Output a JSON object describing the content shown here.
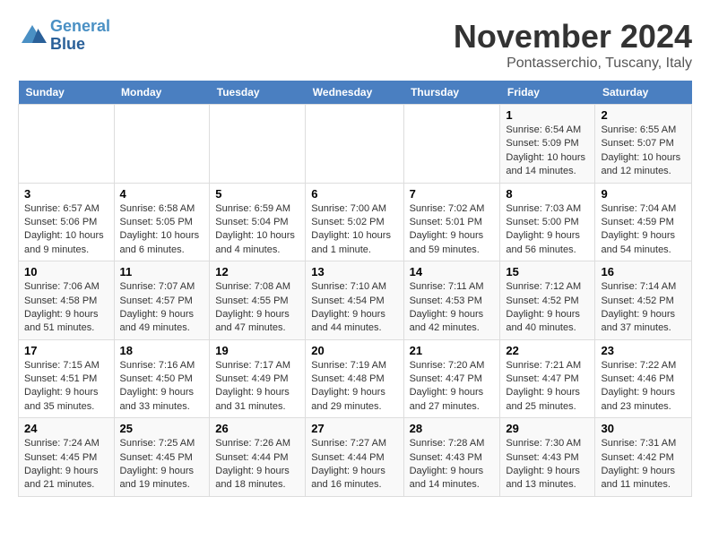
{
  "header": {
    "logo_line1": "General",
    "logo_line2": "Blue",
    "month": "November 2024",
    "location": "Pontasserchio, Tuscany, Italy"
  },
  "weekdays": [
    "Sunday",
    "Monday",
    "Tuesday",
    "Wednesday",
    "Thursday",
    "Friday",
    "Saturday"
  ],
  "weeks": [
    [
      {
        "day": "",
        "info": ""
      },
      {
        "day": "",
        "info": ""
      },
      {
        "day": "",
        "info": ""
      },
      {
        "day": "",
        "info": ""
      },
      {
        "day": "",
        "info": ""
      },
      {
        "day": "1",
        "info": "Sunrise: 6:54 AM\nSunset: 5:09 PM\nDaylight: 10 hours and 14 minutes."
      },
      {
        "day": "2",
        "info": "Sunrise: 6:55 AM\nSunset: 5:07 PM\nDaylight: 10 hours and 12 minutes."
      }
    ],
    [
      {
        "day": "3",
        "info": "Sunrise: 6:57 AM\nSunset: 5:06 PM\nDaylight: 10 hours and 9 minutes."
      },
      {
        "day": "4",
        "info": "Sunrise: 6:58 AM\nSunset: 5:05 PM\nDaylight: 10 hours and 6 minutes."
      },
      {
        "day": "5",
        "info": "Sunrise: 6:59 AM\nSunset: 5:04 PM\nDaylight: 10 hours and 4 minutes."
      },
      {
        "day": "6",
        "info": "Sunrise: 7:00 AM\nSunset: 5:02 PM\nDaylight: 10 hours and 1 minute."
      },
      {
        "day": "7",
        "info": "Sunrise: 7:02 AM\nSunset: 5:01 PM\nDaylight: 9 hours and 59 minutes."
      },
      {
        "day": "8",
        "info": "Sunrise: 7:03 AM\nSunset: 5:00 PM\nDaylight: 9 hours and 56 minutes."
      },
      {
        "day": "9",
        "info": "Sunrise: 7:04 AM\nSunset: 4:59 PM\nDaylight: 9 hours and 54 minutes."
      }
    ],
    [
      {
        "day": "10",
        "info": "Sunrise: 7:06 AM\nSunset: 4:58 PM\nDaylight: 9 hours and 51 minutes."
      },
      {
        "day": "11",
        "info": "Sunrise: 7:07 AM\nSunset: 4:57 PM\nDaylight: 9 hours and 49 minutes."
      },
      {
        "day": "12",
        "info": "Sunrise: 7:08 AM\nSunset: 4:55 PM\nDaylight: 9 hours and 47 minutes."
      },
      {
        "day": "13",
        "info": "Sunrise: 7:10 AM\nSunset: 4:54 PM\nDaylight: 9 hours and 44 minutes."
      },
      {
        "day": "14",
        "info": "Sunrise: 7:11 AM\nSunset: 4:53 PM\nDaylight: 9 hours and 42 minutes."
      },
      {
        "day": "15",
        "info": "Sunrise: 7:12 AM\nSunset: 4:52 PM\nDaylight: 9 hours and 40 minutes."
      },
      {
        "day": "16",
        "info": "Sunrise: 7:14 AM\nSunset: 4:52 PM\nDaylight: 9 hours and 37 minutes."
      }
    ],
    [
      {
        "day": "17",
        "info": "Sunrise: 7:15 AM\nSunset: 4:51 PM\nDaylight: 9 hours and 35 minutes."
      },
      {
        "day": "18",
        "info": "Sunrise: 7:16 AM\nSunset: 4:50 PM\nDaylight: 9 hours and 33 minutes."
      },
      {
        "day": "19",
        "info": "Sunrise: 7:17 AM\nSunset: 4:49 PM\nDaylight: 9 hours and 31 minutes."
      },
      {
        "day": "20",
        "info": "Sunrise: 7:19 AM\nSunset: 4:48 PM\nDaylight: 9 hours and 29 minutes."
      },
      {
        "day": "21",
        "info": "Sunrise: 7:20 AM\nSunset: 4:47 PM\nDaylight: 9 hours and 27 minutes."
      },
      {
        "day": "22",
        "info": "Sunrise: 7:21 AM\nSunset: 4:47 PM\nDaylight: 9 hours and 25 minutes."
      },
      {
        "day": "23",
        "info": "Sunrise: 7:22 AM\nSunset: 4:46 PM\nDaylight: 9 hours and 23 minutes."
      }
    ],
    [
      {
        "day": "24",
        "info": "Sunrise: 7:24 AM\nSunset: 4:45 PM\nDaylight: 9 hours and 21 minutes."
      },
      {
        "day": "25",
        "info": "Sunrise: 7:25 AM\nSunset: 4:45 PM\nDaylight: 9 hours and 19 minutes."
      },
      {
        "day": "26",
        "info": "Sunrise: 7:26 AM\nSunset: 4:44 PM\nDaylight: 9 hours and 18 minutes."
      },
      {
        "day": "27",
        "info": "Sunrise: 7:27 AM\nSunset: 4:44 PM\nDaylight: 9 hours and 16 minutes."
      },
      {
        "day": "28",
        "info": "Sunrise: 7:28 AM\nSunset: 4:43 PM\nDaylight: 9 hours and 14 minutes."
      },
      {
        "day": "29",
        "info": "Sunrise: 7:30 AM\nSunset: 4:43 PM\nDaylight: 9 hours and 13 minutes."
      },
      {
        "day": "30",
        "info": "Sunrise: 7:31 AM\nSunset: 4:42 PM\nDaylight: 9 hours and 11 minutes."
      }
    ]
  ]
}
